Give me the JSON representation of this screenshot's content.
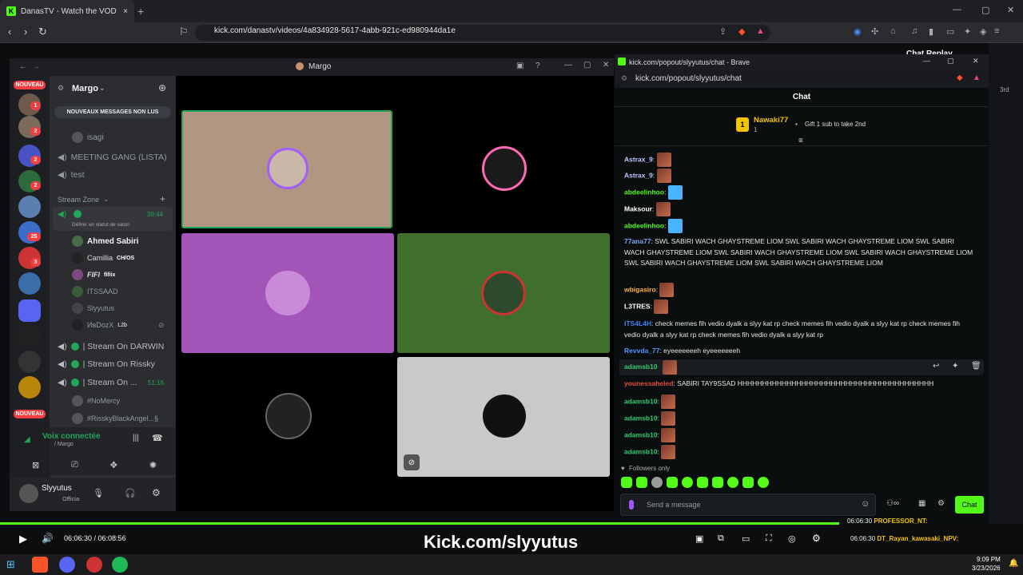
{
  "browser": {
    "tab_title": "DanasTV - Watch the VOD on Ki",
    "url": "kick.com/danastv/videos/4a834928-5617-4abb-921c-ed980944da1e"
  },
  "discord": {
    "window_title": "Margo",
    "server_name": "Margo",
    "new_label": "NOUVEAU",
    "unread_banner": "NOUVEAUX MESSAGES NON LUS",
    "channels": {
      "isagi": "isagi",
      "meeting": "MEETING GANG (LISTA)",
      "test": "test",
      "category": "Stream Zone",
      "voice_timer": "39:44",
      "status_hint": "Définir un statut de salon",
      "members": [
        "Ahmed Sabiri",
        "Camillia",
        "FIFI",
        "ITSSAAD",
        "Slyyutus",
        "ИвDozX"
      ],
      "member_tags": {
        "camillia": "CH/OS",
        "fifi": "fifiix",
        "ivdozx": "L2b"
      },
      "stream_darwin": "| Stream On DARWIN",
      "stream_rissky": "| Stream On Rissky",
      "stream_third": "| Stream On ...",
      "stream_third_timer": "51:16",
      "sub_members": [
        "#NoMercy",
        "#RisskyBlackAngel...§"
      ]
    },
    "voice_status": "Voix connectée",
    "voice_channel": "/ Margo",
    "user_name": "Slyyutus",
    "user_status": "Officia",
    "badges": [
      "2",
      "1",
      "2",
      "2",
      "2",
      "25",
      "3"
    ]
  },
  "kick": {
    "window_title": "kick.com/popout/slyyutus/chat - Brave",
    "url": "kick.com/popout/slyyutus/chat",
    "header": "Chat",
    "pinned_user": "Nawaki77",
    "pinned_count": "1",
    "pinned_rank": "1",
    "gift_text": "Gift 1 sub to take 2nd",
    "messages": [
      {
        "user": "Astrax_9",
        "color": "#b9c7ff",
        "text": ""
      },
      {
        "user": "Astrax_9",
        "color": "#b9c7ff",
        "text": ""
      },
      {
        "user": "abdeelinhoo",
        "color": "#53fc18",
        "text": ""
      },
      {
        "user": "Maksour",
        "color": "#ffffff",
        "text": ""
      },
      {
        "user": "abdeelinhoo",
        "color": "#53fc18",
        "text": ""
      },
      {
        "user": "77ana77",
        "color": "#7aa7ff",
        "text": "SWL SABIRI WACH GHAYSTREME LIOM SWL SABIRI WACH GHAYSTREME LIOM SWL SABIRI WACH GHAYSTREME LIOM SWL SABIRI WACH GHAYSTREME LIOM SWL SABIRI WACH GHAYSTREME LIOM SWL SABIRI WACH GHAYSTREME LIOM SWL SABIRI WACH GHAYSTREME LIOM"
      },
      {
        "user": "wbigasiro",
        "color": "#ffb347",
        "text": ""
      },
      {
        "user": "L3TRES",
        "color": "#ffffff",
        "text": ""
      },
      {
        "user": "ITS4L4H",
        "color": "#3b82f6",
        "text": "check memes fih vedio dyalk a slyy kat rp check memes fih vedio dyalk a slyy kat rp check memes fih vedio dyalk a slyy kat rp check memes fih vedio dyalk a slyy kat rp"
      },
      {
        "user": "Revvda_77",
        "color": "#4c9aff",
        "text": "eyeeeeeeeh eyeeeeeeeh"
      },
      {
        "user": "adamsb10",
        "color": "#2ecc71",
        "text": ""
      },
      {
        "user": "younessaheled",
        "color": "#e74c3c",
        "text": "SABIRI TAY9SSAD HHHHHHHHHHHHHHHHHHHHHHHHHHHHHHHHHHHHHHHH"
      },
      {
        "user": "adamsb10",
        "color": "#2ecc71",
        "text": ""
      },
      {
        "user": "adamsb10",
        "color": "#2ecc71",
        "text": ""
      },
      {
        "user": "adamsb10",
        "color": "#2ecc71",
        "text": ""
      },
      {
        "user": "adamsb10",
        "color": "#2ecc71",
        "text": ""
      }
    ],
    "followers_only": "Followers only",
    "input_placeholder": "Send a message",
    "chat_button": "Chat"
  },
  "right_panel": {
    "title": "Chat Replay",
    "rank_label": "3rd",
    "replay": [
      {
        "time": "06:06:30",
        "user": "PROFESSOR_NT:"
      },
      {
        "time": "06:06:30",
        "user": "DT_Rayan_kawasaki_NPV:"
      }
    ]
  },
  "player": {
    "time": "06:06:30 / 06:08:56",
    "watermark": "Kick.com/slyyutus",
    "progress": 0.82
  },
  "taskbar": {
    "clock_time": "9:09 PM",
    "clock_date": "3/23/2026"
  },
  "colors": {
    "kick_green": "#53fc18",
    "discord_green": "#23a55a"
  }
}
